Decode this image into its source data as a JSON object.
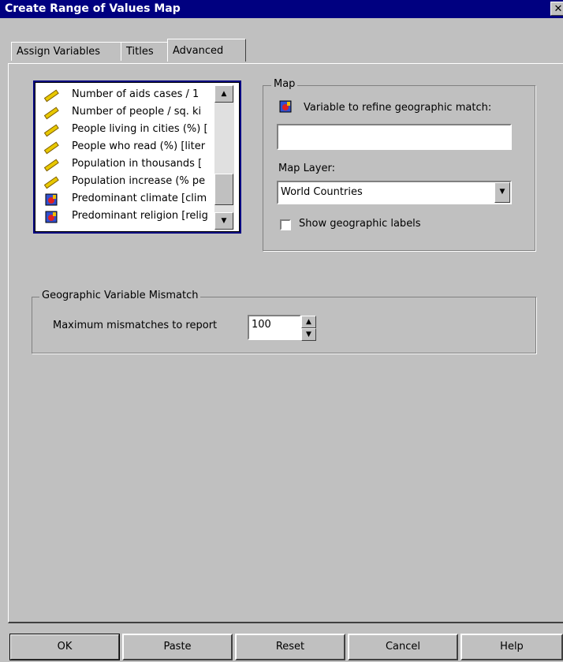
{
  "window": {
    "title": "Create Range of Values Map",
    "close_glyph": "✕"
  },
  "tabs": [
    {
      "label": "Assign Variables"
    },
    {
      "label": "Titles"
    },
    {
      "label": "Advanced",
      "active": true
    }
  ],
  "variables": {
    "items": [
      {
        "label": "Number of aids cases / 1",
        "icon": "ruler-icon"
      },
      {
        "label": "Number of people / sq. ki",
        "icon": "ruler-icon"
      },
      {
        "label": "People living in cities (%) [",
        "icon": "ruler-icon"
      },
      {
        "label": "People who read (%) [liter",
        "icon": "ruler-icon"
      },
      {
        "label": "Population in thousands [",
        "icon": "ruler-icon"
      },
      {
        "label": "Population increase (% pe",
        "icon": "ruler-icon"
      },
      {
        "label": "Predominant climate [clim",
        "icon": "nominal-icon"
      },
      {
        "label": "Predominant religion [relig",
        "icon": "nominal-icon"
      }
    ]
  },
  "map_group": {
    "legend": "Map",
    "refine_label": "Variable to refine geographic match:",
    "refine_value": "",
    "layer_label": "Map Layer:",
    "layer_value": "World Countries",
    "show_labels_label": "Show geographic labels",
    "show_labels_checked": false
  },
  "mismatch_group": {
    "legend": "Geographic Variable Mismatch",
    "max_label": "Maximum mismatches to report",
    "max_value": "100"
  },
  "buttons": {
    "ok": "OK",
    "paste": "Paste",
    "reset": "Reset",
    "cancel": "Cancel",
    "help": "Help"
  },
  "colors": {
    "title_bar": "#000080",
    "dialog_bg": "#c0c0c0"
  }
}
